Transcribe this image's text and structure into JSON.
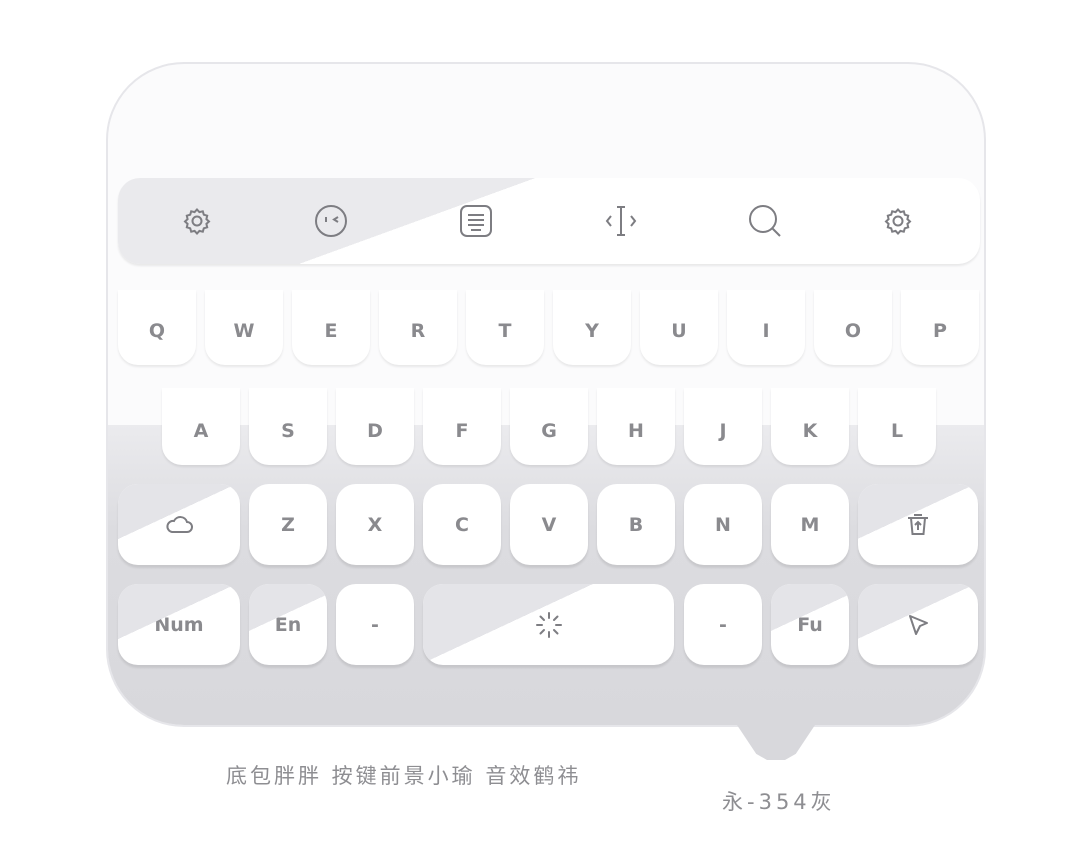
{
  "toolbar": {
    "icons": [
      "gear-icon",
      "emoji-icon",
      "keyboard-layout-icon",
      "cursor-icon",
      "search-icon",
      "gear-icon"
    ]
  },
  "keys": {
    "row1": [
      "Q",
      "W",
      "E",
      "R",
      "T",
      "Y",
      "U",
      "I",
      "O",
      "P"
    ],
    "row2": [
      "A",
      "S",
      "D",
      "F",
      "G",
      "H",
      "J",
      "K",
      "L"
    ],
    "row3": [
      "Z",
      "X",
      "C",
      "V",
      "B",
      "N",
      "M"
    ],
    "row4": {
      "num": "Num",
      "en": "En",
      "dash_left": "-",
      "dash_right": "-",
      "fu": "Fu"
    }
  },
  "caption": "底包胖胖 按键前景小瑜 音效鹤祎",
  "color_label": "永-354灰",
  "colors": {
    "key_text": "#8a8a8e",
    "key_bg": "#ffffff",
    "panel_bottom": "#d8d8dc"
  }
}
